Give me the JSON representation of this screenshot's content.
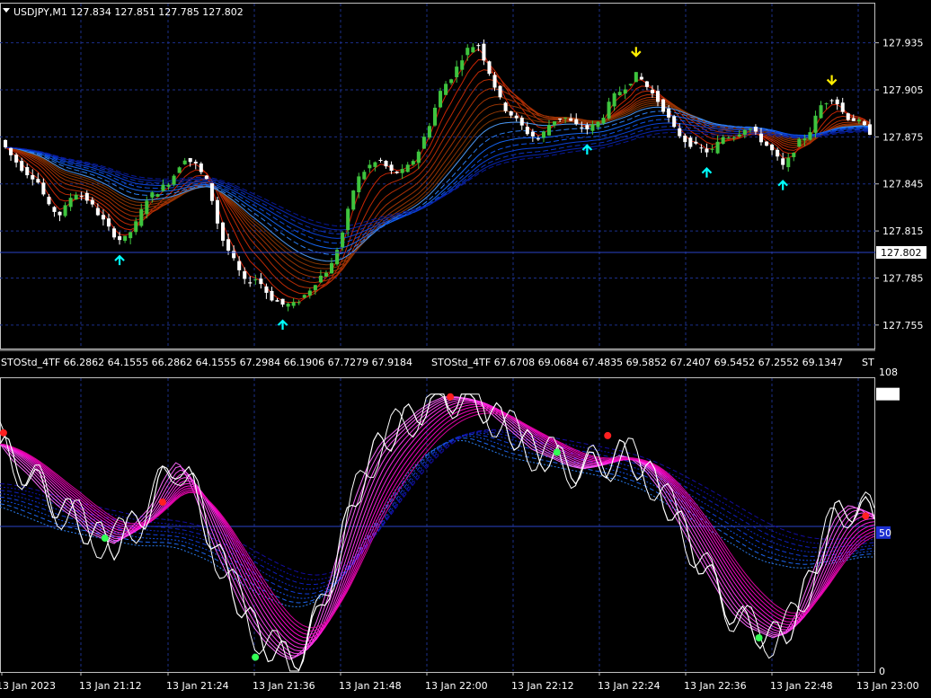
{
  "symbol_header": "USDJPY,M1  127.834 127.851 127.785 127.802",
  "indicator_header_1": "STOStd_4TF 66.2862 64.1555 66.2862 64.1555 67.2984 66.1906 67.7279 67.9184",
  "indicator_header_2": "STOStd_4TF 67.6708 69.0684 67.4835 69.5852 67.2407 69.5452 67.2552 69.1347",
  "indicator_header_tail": "ST",
  "current_price": "127.802",
  "colors": {
    "background": "#000000",
    "grid": "#1b2f8a",
    "bull": "#3ec43e",
    "bear": "#ffffff",
    "up_arrow": "#00ffff",
    "down_arrow": "#ffee00",
    "stoch_main": "#ff33ff",
    "stoch_slow": "#3377ff",
    "dot_high": "#ff2020",
    "dot_low": "#33ff55"
  },
  "chart_data": [
    {
      "type": "candlestick",
      "title": "USDJPY,M1",
      "ylim": [
        127.74,
        127.96
      ],
      "y_ticks": [
        "127.935",
        "127.905",
        "127.875",
        "127.845",
        "127.815",
        "127.785",
        "127.755"
      ],
      "close_trend": [
        127.873,
        127.862,
        127.853,
        127.848,
        127.83,
        127.825,
        127.84,
        127.836,
        127.826,
        127.815,
        127.808,
        127.818,
        127.836,
        127.841,
        127.848,
        127.862,
        127.857,
        127.845,
        127.812,
        127.797,
        127.782,
        127.785,
        127.773,
        127.768,
        127.768,
        127.775,
        127.785,
        127.792,
        127.815,
        127.846,
        127.856,
        127.86,
        127.852,
        127.853,
        127.863,
        127.882,
        127.905,
        127.915,
        127.93,
        127.935,
        127.915,
        127.895,
        127.887,
        127.878,
        127.873,
        127.885,
        127.888,
        127.882,
        127.88,
        127.885,
        127.9,
        127.907,
        127.915,
        127.905,
        127.895,
        127.88,
        127.872,
        127.868,
        127.865,
        127.875,
        127.876,
        127.882,
        127.874,
        127.866,
        127.855,
        127.87,
        127.877,
        127.895,
        127.901,
        127.888,
        127.885,
        127.878
      ]
    },
    {
      "type": "line",
      "title": "STOStd_4TF",
      "ylim": [
        0,
        108
      ],
      "y_ticks": [
        "108",
        "100",
        "50",
        "0"
      ],
      "highlighted_level": "50",
      "x_tick_labels": [
        "13 Jan 2023",
        "13 Jan 21:12",
        "13 Jan 21:24",
        "13 Jan 21:36",
        "13 Jan 21:48",
        "13 Jan 22:00",
        "13 Jan 22:12",
        "13 Jan 22:24",
        "13 Jan 22:36",
        "13 Jan 22:48",
        "13 Jan 23:00"
      ],
      "main_trend": [
        82,
        76,
        72,
        67,
        62,
        58,
        55,
        50,
        48,
        46,
        50,
        55,
        60,
        70,
        76,
        68,
        56,
        44,
        34,
        24,
        16,
        10,
        6,
        4,
        8,
        18,
        32,
        48,
        62,
        74,
        82,
        86,
        90,
        94,
        97,
        99,
        99,
        98,
        96,
        92,
        88,
        84,
        80,
        78,
        76,
        74,
        73,
        74,
        76,
        78,
        76,
        72,
        66,
        58,
        50,
        42,
        34,
        26,
        20,
        16,
        14,
        12,
        14,
        22,
        34,
        46,
        56,
        60,
        58,
        55
      ],
      "slow_trend": [
        64,
        62,
        60,
        58,
        56,
        55,
        54,
        53,
        52,
        51,
        50,
        50,
        50,
        49,
        47,
        45,
        42,
        38,
        35,
        32,
        30,
        28,
        28,
        30,
        34,
        40,
        48,
        56,
        64,
        72,
        78,
        83,
        86,
        88,
        88,
        86,
        84,
        82,
        81,
        80,
        79,
        78,
        77,
        76,
        75,
        74,
        72,
        70,
        67,
        64,
        61,
        58,
        55,
        52,
        49,
        46,
        44,
        43,
        42,
        42,
        43,
        44,
        45,
        46,
        46
      ],
      "markers": [
        {
          "x": 0.004,
          "y": 86,
          "kind": "high"
        },
        {
          "x": 0.12,
          "y": 48,
          "kind": "low"
        },
        {
          "x": 0.186,
          "y": 61,
          "kind": "high"
        },
        {
          "x": 0.292,
          "y": 5,
          "kind": "low"
        },
        {
          "x": 0.515,
          "y": 99,
          "kind": "high"
        },
        {
          "x": 0.637,
          "y": 79,
          "kind": "low"
        },
        {
          "x": 0.695,
          "y": 85,
          "kind": "high"
        },
        {
          "x": 0.868,
          "y": 12,
          "kind": "low"
        },
        {
          "x": 0.99,
          "y": 56,
          "kind": "high"
        }
      ]
    }
  ]
}
